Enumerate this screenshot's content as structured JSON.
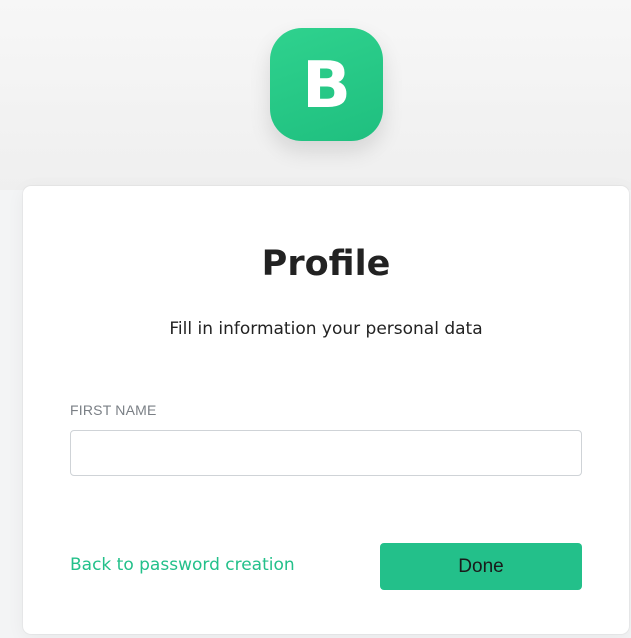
{
  "app": {
    "logo_letter": "B",
    "brand_color": "#23c08a"
  },
  "profile": {
    "title": "Profile",
    "subtitle": "Fill in information your personal data",
    "first_name": {
      "label": "FIRST NAME",
      "value": "",
      "placeholder": ""
    },
    "back_link_label": "Back to password creation",
    "done_label": "Done"
  }
}
